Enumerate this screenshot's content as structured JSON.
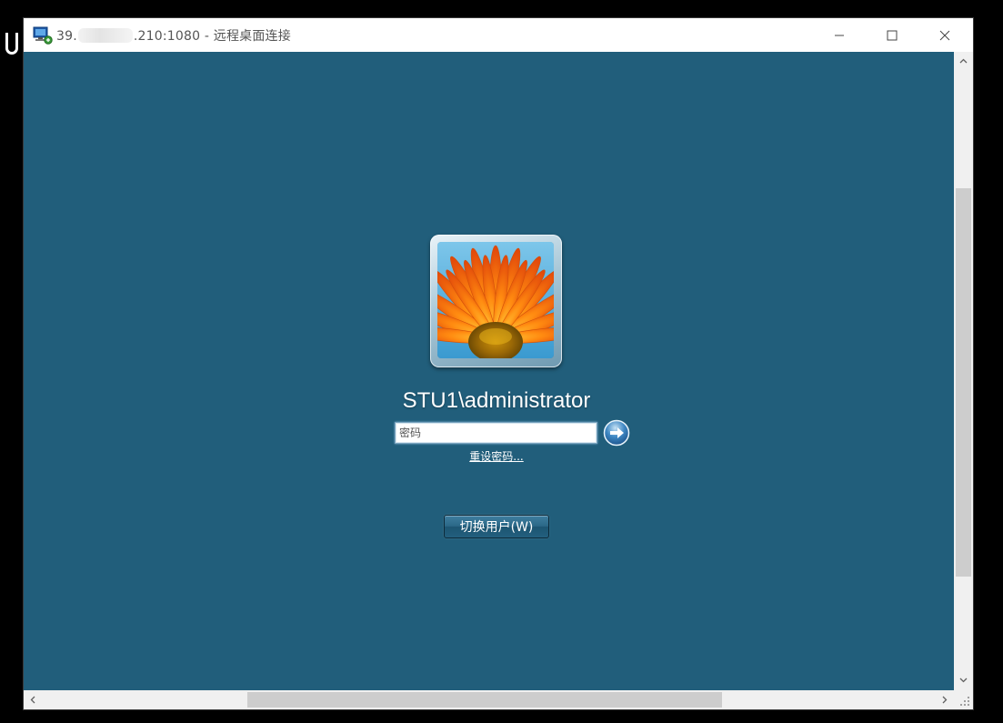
{
  "window": {
    "title_prefix": "39.",
    "title_suffix": ".210:1080 - 远程桌面连接",
    "minimize_label": "—",
    "maximize_label": "☐",
    "close_label": "✕"
  },
  "login": {
    "username": "STU1\\administrator",
    "password_placeholder": "密码",
    "password_value": "",
    "reset_password_link": "重设密码...",
    "switch_user_button": "切换用户(W)"
  },
  "icons": {
    "app": "remote-desktop-icon",
    "submit": "arrow-right-circle-icon",
    "avatar": "orange-flower-avatar"
  },
  "colors": {
    "remote_background": "#215e7b",
    "titlebar": "#ffffff",
    "scrollbar": "#f0f0f0"
  }
}
